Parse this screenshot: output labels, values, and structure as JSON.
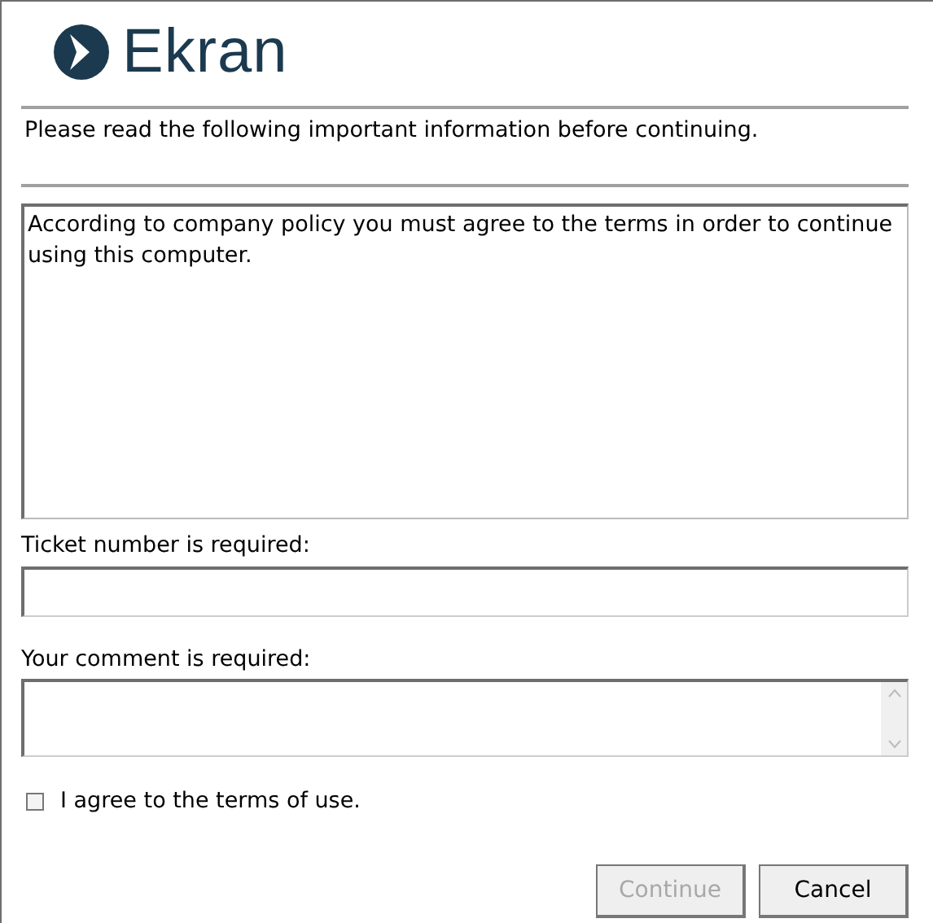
{
  "logo": {
    "text": "Ekran"
  },
  "intro": "Please read the following important information before continuing.",
  "terms_text": "According to company policy you must agree to the terms in order to continue using this computer.",
  "ticket": {
    "label": "Ticket number is required:"
  },
  "comment": {
    "label": "Your comment is required:"
  },
  "agree": {
    "label": "I agree to the terms of use.",
    "checked": false
  },
  "buttons": [
    {
      "label": "Continue",
      "disabled": true
    },
    {
      "label": "Cancel",
      "disabled": false
    }
  ]
}
